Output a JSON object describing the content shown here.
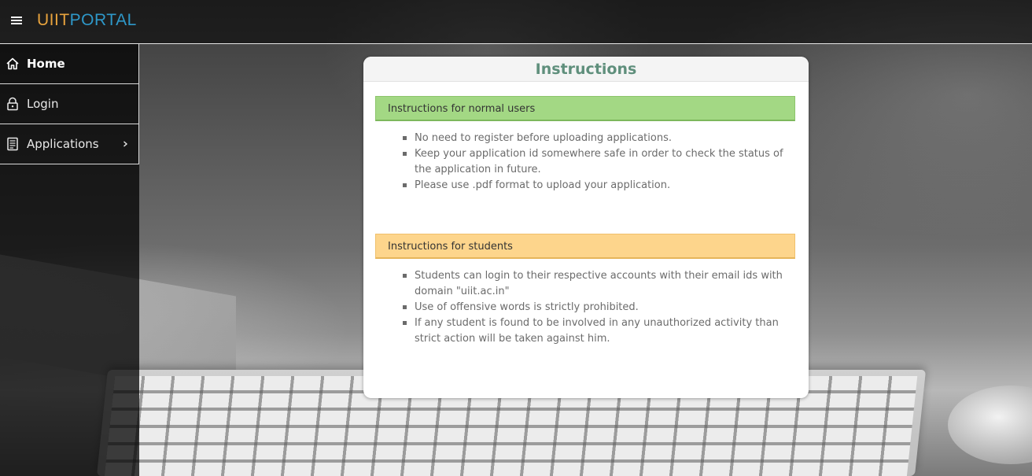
{
  "header": {
    "brand_part1": "UIIT",
    "brand_part2": "PORTAL",
    "menu_icon": "hamburger-icon",
    "brand_colors": {
      "part1": "#e8a33d",
      "part2": "#2e98c9"
    }
  },
  "sidebar": {
    "items": [
      {
        "label": "Home",
        "icon": "home-icon",
        "active": true
      },
      {
        "label": "Login",
        "icon": "lock-icon",
        "active": false
      },
      {
        "label": "Applications",
        "icon": "document-icon",
        "active": false,
        "has_submenu": true
      }
    ]
  },
  "panel": {
    "title": "Instructions",
    "sections": [
      {
        "heading": "Instructions for normal users",
        "color": "#a3d884",
        "items": [
          "No need to register before uploading applications.",
          "Keep your application id somewhere safe in order to check the status of the application in future.",
          "Please use .pdf format to upload your application."
        ]
      },
      {
        "heading": "Instructions for students",
        "color": "#fdd58c",
        "items": [
          "Students can login to their respective accounts with their email ids with domain \"uiit.ac.in\"",
          "Use of offensive words is strictly prohibited.",
          "If any student is found to be involved in any unauthorized activity than strict action will be taken against him."
        ]
      }
    ]
  }
}
